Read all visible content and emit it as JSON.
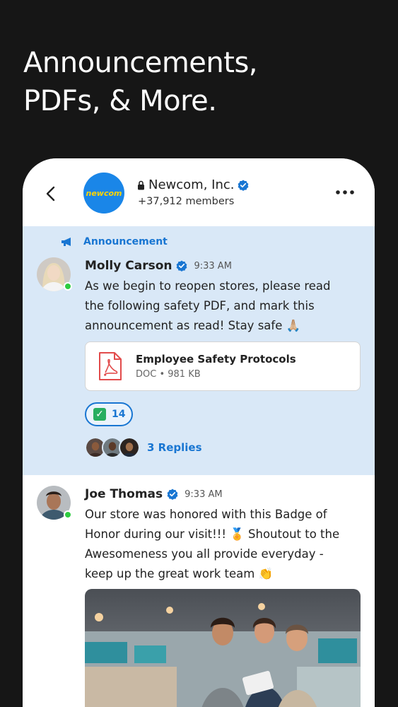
{
  "headline": {
    "line1": "Announcements,",
    "line2": "PDFs, & More."
  },
  "header": {
    "group_name": "Newcom, Inc.",
    "members": "+37,912 members",
    "avatar_text": "newcom"
  },
  "announcement": {
    "tag": "Announcement",
    "author": "Molly Carson",
    "time": "9:33 AM",
    "lines": [
      "As we begin to reopen stores, please read",
      "the following safety PDF, and mark this",
      "announcement as read! Stay safe 🙏🏼"
    ],
    "attachment": {
      "title": "Employee Safety Protocols",
      "meta": "DOC • 981 KB"
    },
    "reaction_count": "14",
    "replies": "3 Replies"
  },
  "post": {
    "author": "Joe Thomas",
    "time": "9:33 AM",
    "lines": [
      "Our store was honored with this Badge of",
      "Honor during our visit!!! 🏅 Shoutout to the",
      "Awesomeness you all provide everyday -",
      "keep up the great work team 👏"
    ]
  },
  "colors": {
    "accent": "#1976d2",
    "announce_bg": "#d9e8f7",
    "online": "#2ecc40",
    "page_bg": "#161616"
  }
}
